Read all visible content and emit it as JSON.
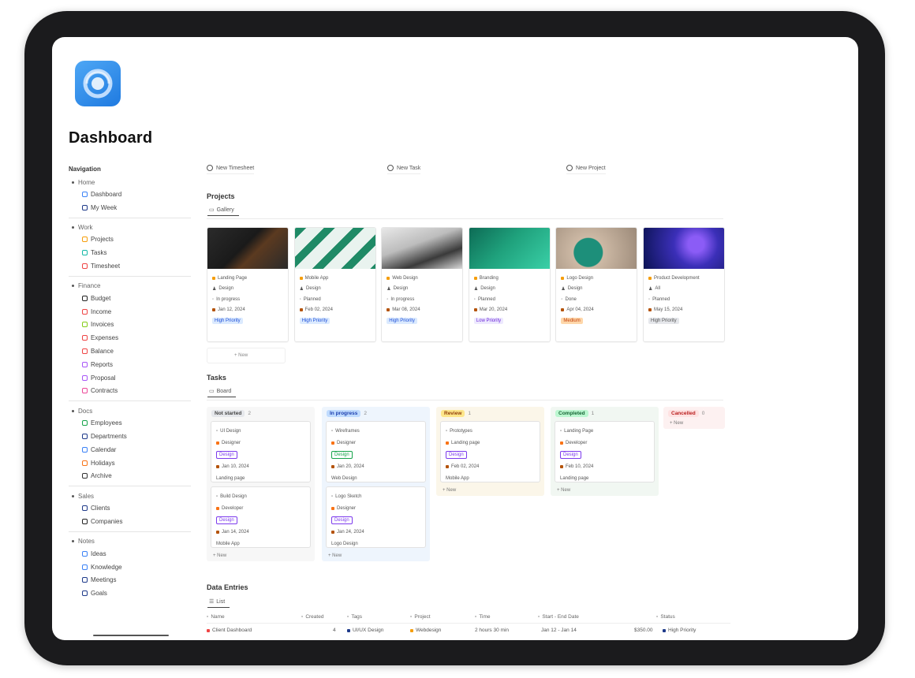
{
  "page_title": "Dashboard",
  "sidebar": {
    "heading": "Navigation",
    "groups": [
      {
        "label": "Home",
        "items": [
          {
            "label": "Dashboard",
            "color": "#3b82f6"
          },
          {
            "label": "My Week",
            "color": "#1e3a8a"
          }
        ]
      },
      {
        "label": "Work",
        "items": [
          {
            "label": "Projects",
            "color": "#f59e0b"
          },
          {
            "label": "Tasks",
            "color": "#14b8a6"
          },
          {
            "label": "Timesheet",
            "color": "#ef4444"
          }
        ]
      },
      {
        "label": "Finance",
        "items": [
          {
            "label": "Budget",
            "color": "#222222"
          },
          {
            "label": "Income",
            "color": "#ef4444"
          },
          {
            "label": "Invoices",
            "color": "#84cc16"
          },
          {
            "label": "Expenses",
            "color": "#ef4444"
          },
          {
            "label": "Balance",
            "color": "#ef4444"
          },
          {
            "label": "Reports",
            "color": "#a855f7"
          },
          {
            "label": "Proposal",
            "color": "#a855f7"
          },
          {
            "label": "Contracts",
            "color": "#ec4899"
          }
        ]
      },
      {
        "label": "Docs",
        "items": [
          {
            "label": "Employees",
            "color": "#16a34a"
          },
          {
            "label": "Departments",
            "color": "#1e3a8a"
          },
          {
            "label": "Calendar",
            "color": "#3b82f6"
          },
          {
            "label": "Holidays",
            "color": "#f97316"
          },
          {
            "label": "Archive",
            "color": "#333333"
          }
        ]
      },
      {
        "label": "Sales",
        "items": [
          {
            "label": "Clients",
            "color": "#1e3a8a"
          },
          {
            "label": "Companies",
            "color": "#222222"
          }
        ]
      },
      {
        "label": "Notes",
        "items": [
          {
            "label": "Ideas",
            "color": "#3b82f6"
          },
          {
            "label": "Knowledge",
            "color": "#3b82f6"
          },
          {
            "label": "Meetings",
            "color": "#1e3a8a"
          },
          {
            "label": "Goals",
            "color": "#1e3a8a"
          }
        ]
      }
    ]
  },
  "actions": [
    "New Timesheet",
    "New Task",
    "New Project"
  ],
  "projects": {
    "title": "Projects",
    "view_label": "Gallery",
    "new_label": "+ New",
    "cards": [
      {
        "name": "Landing Page",
        "name_color": "#f59e0b",
        "owner": "Design",
        "meta": "In progress",
        "rows": [
          "Due Date",
          "Jan 12, 2024"
        ],
        "tag": "High Priority",
        "tag_bg": "#dbeafe",
        "tag_fg": "#1d4ed8",
        "cover": "linear-gradient(135deg,#2b2b2b 0%,#1a1a1a 45%,#5b3a20 60%,#2a2a2a 100%)"
      },
      {
        "name": "Mobile App",
        "name_color": "#f59e0b",
        "owner": "Design",
        "meta": "Planned",
        "rows": [
          "Due Date",
          "Feb 02, 2024"
        ],
        "tag": "High Priority",
        "tag_bg": "#dbeafe",
        "tag_fg": "#1d4ed8",
        "cover": "repeating-linear-gradient(135deg,#1f8a66 0 10px,#e9f3ef 10px 26px)"
      },
      {
        "name": "Web Design",
        "name_color": "#f59e0b",
        "owner": "Design",
        "meta": "In progress",
        "rows": [
          "Due Date",
          "Mar 08, 2024"
        ],
        "tag": "High Priority",
        "tag_bg": "#dbeafe",
        "tag_fg": "#1d4ed8",
        "cover": "linear-gradient(160deg,#e8e8e8 0%,#bdbdbd 40%,#3a3a3a 70%,#d9d9d9 100%)"
      },
      {
        "name": "Branding",
        "name_color": "#f59e0b",
        "owner": "Design",
        "meta": "Planned",
        "rows": [
          "Due Date",
          "Mar 20, 2024"
        ],
        "tag": "Low Priority",
        "tag_bg": "#ede9fe",
        "tag_fg": "#6d28d9",
        "cover": "linear-gradient(135deg,#0d6b55 0%,#1fa17c 45%,#3ad0a7 100%)"
      },
      {
        "name": "Logo Design",
        "name_color": "#f59e0b",
        "owner": "Design",
        "meta": "Done",
        "rows": [
          "Due Date",
          "Apr 04, 2024"
        ],
        "tag": "Medium",
        "tag_bg": "#fed7aa",
        "tag_fg": "#c2410c",
        "cover": "radial-gradient(circle at 40% 60%,#1d8f7a 0 18px,#cdb9a5 19px,#9c8a79 100%)"
      },
      {
        "name": "Product Development",
        "name_color": "#f59e0b",
        "owner": "All",
        "meta": "Planned",
        "rows": [
          "Due Date",
          "May 15, 2024"
        ],
        "tag": "High Priority",
        "tag_bg": "#e5e7eb",
        "tag_fg": "#555555",
        "cover": "radial-gradient(circle at 65% 40%,#8b5cf6 0 10px,#3b2fb8 28px,#0b1354 100%)"
      }
    ]
  },
  "tasks": {
    "title": "Tasks",
    "view_label": "Board",
    "new_label": "+ New",
    "columns": [
      {
        "status": "Not started",
        "count": "2",
        "pill_bg": "#e5e7eb",
        "pill_fg": "#444",
        "bg": "#f7f7f7",
        "cards": [
          {
            "title": "UI Design",
            "assignee": "Designer",
            "tag": "Design",
            "tag_color": "#7c3aed",
            "date": "Jan 10, 2024",
            "note": "Landing page"
          },
          {
            "title": "Build Design",
            "assignee": "Developer",
            "tag": "Design",
            "tag_color": "#7c3aed",
            "date": "Jan 14, 2024",
            "note": "Mobile App"
          }
        ]
      },
      {
        "status": "In progress",
        "count": "2",
        "pill_bg": "#bfdbfe",
        "pill_fg": "#1e40af",
        "bg": "#eef5fd",
        "cards": [
          {
            "title": "Wireframes",
            "assignee": "Designer",
            "tag": "Design",
            "tag_color": "#16a34a",
            "date": "Jan 20, 2024",
            "note": "Web Design"
          },
          {
            "title": "Logo Sketch",
            "assignee": "Designer",
            "tag": "Design",
            "tag_color": "#7c3aed",
            "date": "Jan 24, 2024",
            "note": "Logo Design"
          }
        ]
      },
      {
        "status": "Review",
        "count": "1",
        "pill_bg": "#fde68a",
        "pill_fg": "#92400e",
        "bg": "#fbf6e9",
        "cards": [
          {
            "title": "Prototypes",
            "assignee": "Landing page",
            "tag": "Design",
            "tag_color": "#7c3aed",
            "date": "Feb 02, 2024",
            "note": "Mobile App"
          }
        ]
      },
      {
        "status": "Completed",
        "count": "1",
        "pill_bg": "#bbf7d0",
        "pill_fg": "#166534",
        "bg": "#f1f7f2",
        "cards": [
          {
            "title": "Landing Page",
            "assignee": "Developer",
            "tag": "Design",
            "tag_color": "#7c3aed",
            "date": "Feb 10, 2024",
            "note": "Landing page"
          }
        ]
      },
      {
        "status": "Cancelled",
        "count": "0",
        "pill_bg": "#fee2e2",
        "pill_fg": "#b91c1c",
        "bg": "#fdf1f1",
        "cards": []
      }
    ]
  },
  "data_entries": {
    "title": "Data Entries",
    "view_label": "List",
    "columns": [
      "Name",
      "Created",
      "Tags",
      "Project",
      "Time",
      "Start - End Date",
      "Status"
    ],
    "row": [
      "Client Dashboard",
      "4",
      "UI/UX Design",
      "Webdesign",
      "2 hours 30 min",
      "Jan 12 - Jan 14",
      "$350.00",
      "High Priority"
    ]
  }
}
